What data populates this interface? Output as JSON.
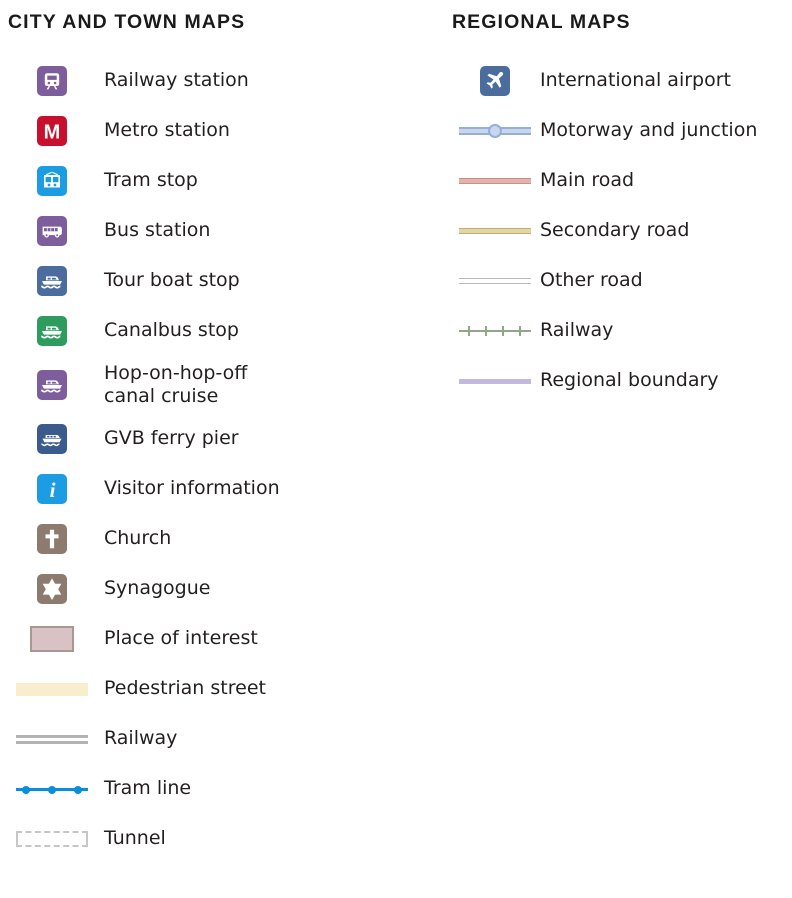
{
  "columns": {
    "city": {
      "title": "CITY AND TOWN MAPS",
      "items": [
        {
          "label": "Railway station",
          "symbol": "railway-station-icon"
        },
        {
          "label": "Metro station",
          "symbol": "metro-station-icon"
        },
        {
          "label": "Tram stop",
          "symbol": "tram-stop-icon"
        },
        {
          "label": "Bus station",
          "symbol": "bus-station-icon"
        },
        {
          "label": "Tour boat stop",
          "symbol": "tour-boat-stop-icon"
        },
        {
          "label": "Canalbus stop",
          "symbol": "canalbus-stop-icon"
        },
        {
          "label": "Hop-on-hop-off\ncanal cruise",
          "symbol": "hop-on-hop-off-canal-cruise-icon"
        },
        {
          "label": "GVB ferry pier",
          "symbol": "gvb-ferry-pier-icon"
        },
        {
          "label": "Visitor information",
          "symbol": "visitor-information-icon"
        },
        {
          "label": "Church",
          "symbol": "church-icon"
        },
        {
          "label": "Synagogue",
          "symbol": "synagogue-icon"
        },
        {
          "label": "Place of interest",
          "symbol": "place-of-interest-swatch"
        },
        {
          "label": "Pedestrian street",
          "symbol": "pedestrian-street-band"
        },
        {
          "label": "Railway",
          "symbol": "railway-line-symbol"
        },
        {
          "label": "Tram line",
          "symbol": "tram-line-symbol"
        },
        {
          "label": "Tunnel",
          "symbol": "tunnel-line-symbol"
        }
      ]
    },
    "regional": {
      "title": "REGIONAL MAPS",
      "items": [
        {
          "label": "International airport",
          "symbol": "international-airport-icon"
        },
        {
          "label": "Motorway and junction",
          "symbol": "motorway-junction-symbol"
        },
        {
          "label": "Main road",
          "symbol": "main-road-symbol"
        },
        {
          "label": "Secondary road",
          "symbol": "secondary-road-symbol"
        },
        {
          "label": "Other road",
          "symbol": "other-road-symbol"
        },
        {
          "label": "Railway",
          "symbol": "regional-railway-symbol"
        },
        {
          "label": "Regional boundary",
          "symbol": "regional-boundary-symbol"
        }
      ]
    }
  },
  "colors": {
    "railway_station_tile": "#7d5d9b",
    "metro_station_tile": "#c8102e",
    "tram_stop_tile": "#1b9ce3",
    "bus_station_tile": "#7d5d9b",
    "tour_boat_tile": "#4a6d9e",
    "canalbus_tile": "#2e9b5f",
    "hop_on_hop_off_tile": "#7d5d9b",
    "gvb_ferry_tile": "#3a5b8c",
    "visitor_information_tile": "#1b9ce3",
    "church_tile": "#8c7b6e",
    "synagogue_tile": "#8c7b6e",
    "airport_tile": "#4a6d9e",
    "place_of_interest_fill": "#d9c2c4",
    "place_of_interest_border": "#a89792",
    "pedestrian_street": "#f8eecd",
    "railway_city": "#b3b3b3",
    "tram_line": "#0a8ed9",
    "tunnel": "#c6c6c6",
    "motorway": "#c9d7ee",
    "motorway_edge": "#94aed6",
    "main_road": "#e6b0ac",
    "secondary_road": "#e3d6a3",
    "other_road": "#ffffff",
    "regional_railway": "#8fa888",
    "regional_boundary": "#c3b8de",
    "text": "#231f20"
  }
}
